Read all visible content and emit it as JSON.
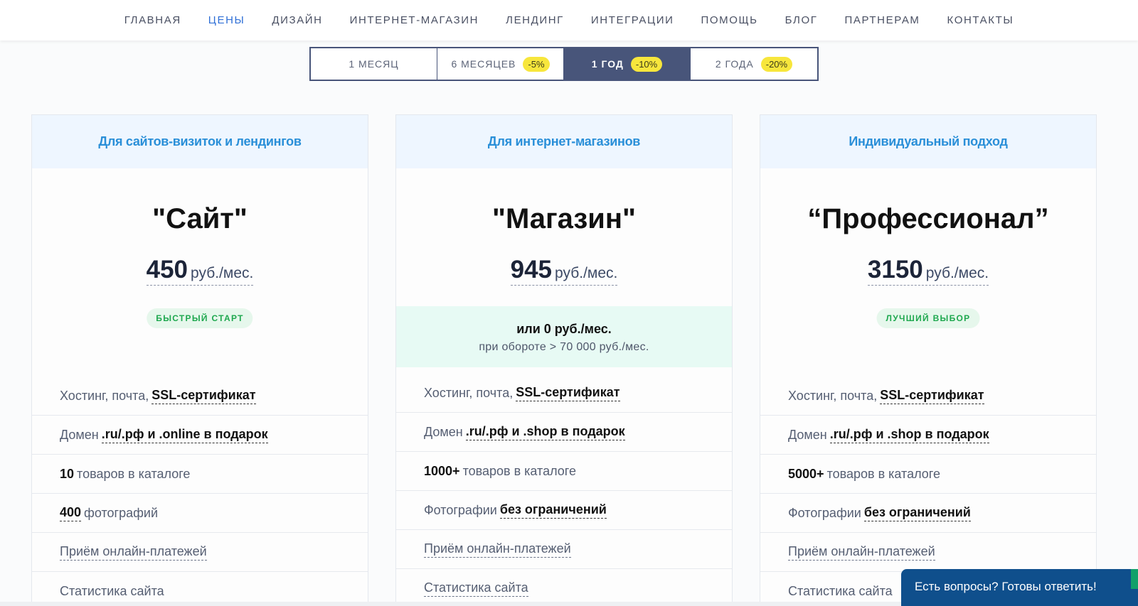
{
  "nav": {
    "items": [
      "ГЛАВНАЯ",
      "ЦЕНЫ",
      "ДИЗАЙН",
      "ИНТЕРНЕТ-МАГАЗИН",
      "ЛЕНДИНГ",
      "ИНТЕГРАЦИИ",
      "ПОМОЩЬ",
      "БЛОГ",
      "ПАРТНЕРАМ",
      "КОНТАКТЫ"
    ],
    "active_index": 1
  },
  "periods": [
    {
      "label": "1 МЕСЯЦ",
      "discount": ""
    },
    {
      "label": "6 МЕСЯЦЕВ",
      "discount": "-5%"
    },
    {
      "label": "1 ГОД",
      "discount": "-10%"
    },
    {
      "label": "2 ГОДА",
      "discount": "-20%"
    }
  ],
  "plans": [
    {
      "header": "Для сайтов-визиток и лендингов",
      "name": "\"Сайт\"",
      "price": "450",
      "unit": "руб./мес.",
      "badge": "БЫСТРЫЙ СТАРТ",
      "features": [
        {
          "pre": "Хостинг, почта,",
          "bold": "SSL-сертификат",
          "post": ""
        },
        {
          "pre": "Домен",
          "bold": ".ru/.рф и .online в подарок",
          "post": ""
        },
        {
          "pre": "",
          "bold": "10",
          "post": "товаров в каталоге"
        },
        {
          "pre": "",
          "bold": "400",
          "post": "фотографий"
        },
        {
          "pre": "Приём онлайн-платежей",
          "bold": "",
          "post": ""
        },
        {
          "pre": "Статистика сайта",
          "bold": "",
          "post": ""
        }
      ]
    },
    {
      "header": "Для интернет-магазинов",
      "name": "\"Магазин\"",
      "price": "945",
      "unit": "руб./мес.",
      "promo_main": "или 0 руб./мес.",
      "promo_sub": "при обороте > 70 000 руб./мес.",
      "features": [
        {
          "pre": "Хостинг, почта,",
          "bold": "SSL-сертификат",
          "post": ""
        },
        {
          "pre": "Домен",
          "bold": ".ru/.рф и .shop в подарок",
          "post": ""
        },
        {
          "pre": "",
          "bold": "1000+",
          "post": "товаров в каталоге"
        },
        {
          "pre": "Фотографии",
          "bold": "без ограничений",
          "post": ""
        },
        {
          "pre": "Приём онлайн-платежей",
          "bold": "",
          "post": ""
        },
        {
          "pre": "Статистика сайта",
          "bold": "",
          "post": ""
        }
      ]
    },
    {
      "header": "Индивидуальный подход",
      "name": "“Профессионал”",
      "price": "3150",
      "unit": "руб./мес.",
      "badge": "ЛУЧШИЙ ВЫБОР",
      "features": [
        {
          "pre": "Хостинг, почта,",
          "bold": "SSL-сертификат",
          "post": ""
        },
        {
          "pre": "Домен",
          "bold": ".ru/.рф и .shop в подарок",
          "post": ""
        },
        {
          "pre": "",
          "bold": "5000+",
          "post": "товаров в каталоге"
        },
        {
          "pre": "Фотографии",
          "bold": "без ограничений",
          "post": ""
        },
        {
          "pre": "Приём онлайн-платежей",
          "bold": "",
          "post": ""
        },
        {
          "pre": "Статистика сайта",
          "bold": "",
          "post": ""
        }
      ]
    }
  ],
  "chat": {
    "label": "Есть вопросы? Готовы ответить!"
  },
  "colors": {
    "accent": "#2f6fd6",
    "selector": "#48557a",
    "discount": "#f7e63c",
    "badge_green": "#1fa84f",
    "chat": "#0f4f8c"
  }
}
